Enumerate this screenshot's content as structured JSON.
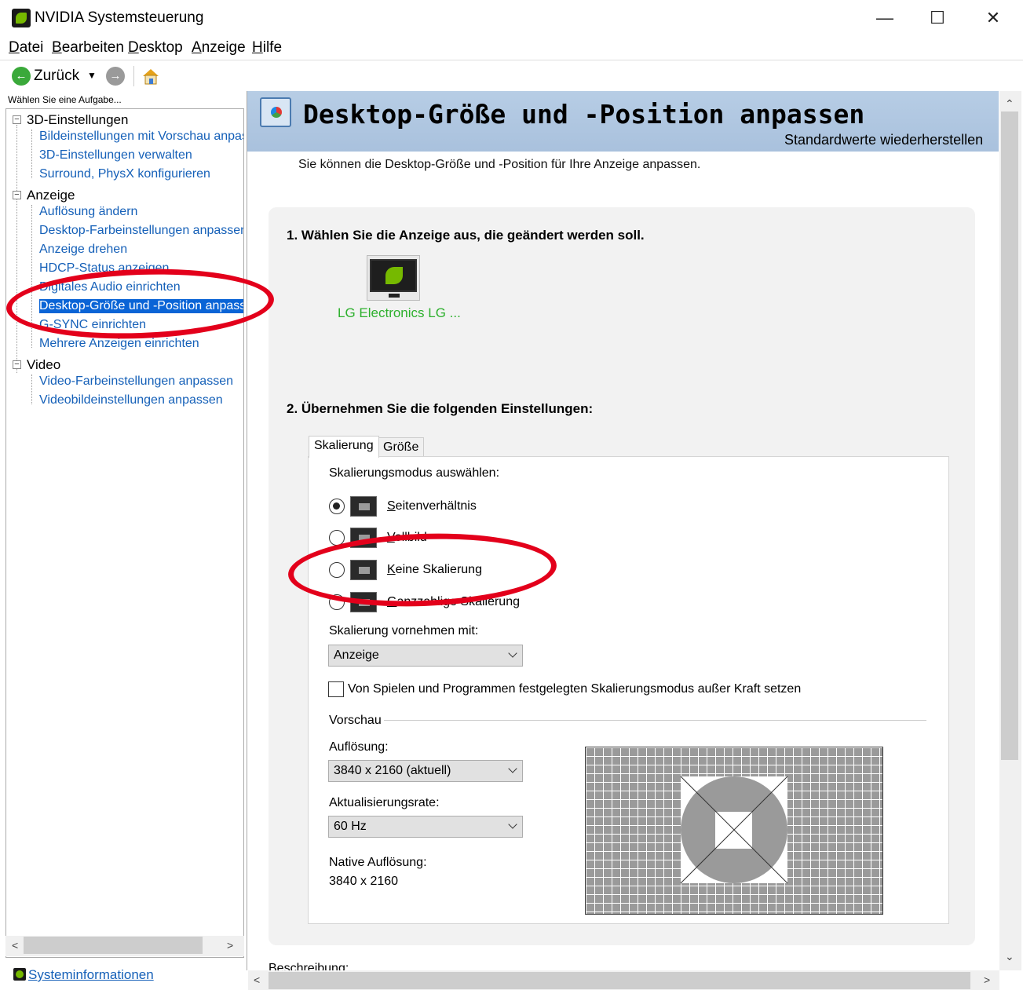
{
  "window": {
    "title": "NVIDIA Systemsteuerung",
    "minimize_glyph": "—",
    "maximize_glyph": "☐",
    "close_glyph": "✕"
  },
  "menu": [
    "Datei",
    "Bearbeiten",
    "Desktop",
    "Anzeige",
    "Hilfe"
  ],
  "toolbar": {
    "back_label": "Zurück",
    "back_icon": "back-arrow-icon",
    "forward_icon": "forward-arrow-icon",
    "home_icon": "home-icon",
    "dropdown_glyph": "▼"
  },
  "sidebar": {
    "hint": "Wählen Sie eine Aufgabe...",
    "categories": [
      {
        "label": "3D-Einstellungen",
        "items": [
          "Bildeinstellungen mit Vorschau anpas",
          "3D-Einstellungen verwalten",
          "Surround, PhysX konfigurieren"
        ]
      },
      {
        "label": "Anzeige",
        "items": [
          "Auflösung ändern",
          "Desktop-Farbeinstellungen anpassen",
          "Anzeige drehen",
          "HDCP-Status anzeigen",
          "Digitales Audio einrichten",
          "Desktop-Größe und -Position anpass",
          "G-SYNC einrichten",
          "Mehrere Anzeigen einrichten"
        ]
      },
      {
        "label": "Video",
        "items": [
          "Video-Farbeinstellungen anpassen",
          "Videobildeinstellungen anpassen"
        ]
      }
    ],
    "selected_item": "Desktop-Größe und -Position anpass",
    "sysinfo_label": "Systeminformationen"
  },
  "main": {
    "title": "Desktop-Größe und -Position anpassen",
    "restore_defaults": "Standardwerte wiederherstellen",
    "description": "Sie können die Desktop-Größe und -Position für Ihre Anzeige anpassen.",
    "step1": "1. Wählen Sie die Anzeige aus, die geändert werden soll.",
    "display_name": "LG Electronics LG ...",
    "step2": "2. Übernehmen Sie die folgenden Einstellungen:",
    "tabs": [
      "Skalierung",
      "Größe"
    ],
    "active_tab": "Skalierung",
    "scaling_mode_label": "Skalierungsmodus auswählen:",
    "scaling_modes": [
      {
        "label": "Seitenverhältnis",
        "selected": true
      },
      {
        "label": "Vollbild",
        "selected": false
      },
      {
        "label": "Keine Skalierung",
        "selected": false
      },
      {
        "label": "Ganzzahlige Skalierung",
        "selected": false
      }
    ],
    "perform_scaling_label": "Skalierung vornehmen mit:",
    "perform_scaling_value": "Anzeige",
    "override_label": "Von Spielen und Programmen festgelegten Skalierungsmodus außer Kraft setzen",
    "override_checked": false,
    "preview_label": "Vorschau",
    "resolution_label": "Auflösung:",
    "resolution_value": "3840 x 2160 (aktuell)",
    "refresh_label": "Aktualisierungsrate:",
    "refresh_value": "60 Hz",
    "native_label": "Native Auflösung:",
    "native_value": "3840 x 2160",
    "footer_label": "Beschreibung:"
  },
  "scroll_arrows": {
    "up": "⌃",
    "down": "⌄",
    "left": "<",
    "right": ">"
  },
  "colors": {
    "header_band": "#b0c7e1",
    "link": "#1560b8",
    "selection": "#0a64d6",
    "annotation": "#e3001b",
    "nvidia_green": "#76b900"
  }
}
